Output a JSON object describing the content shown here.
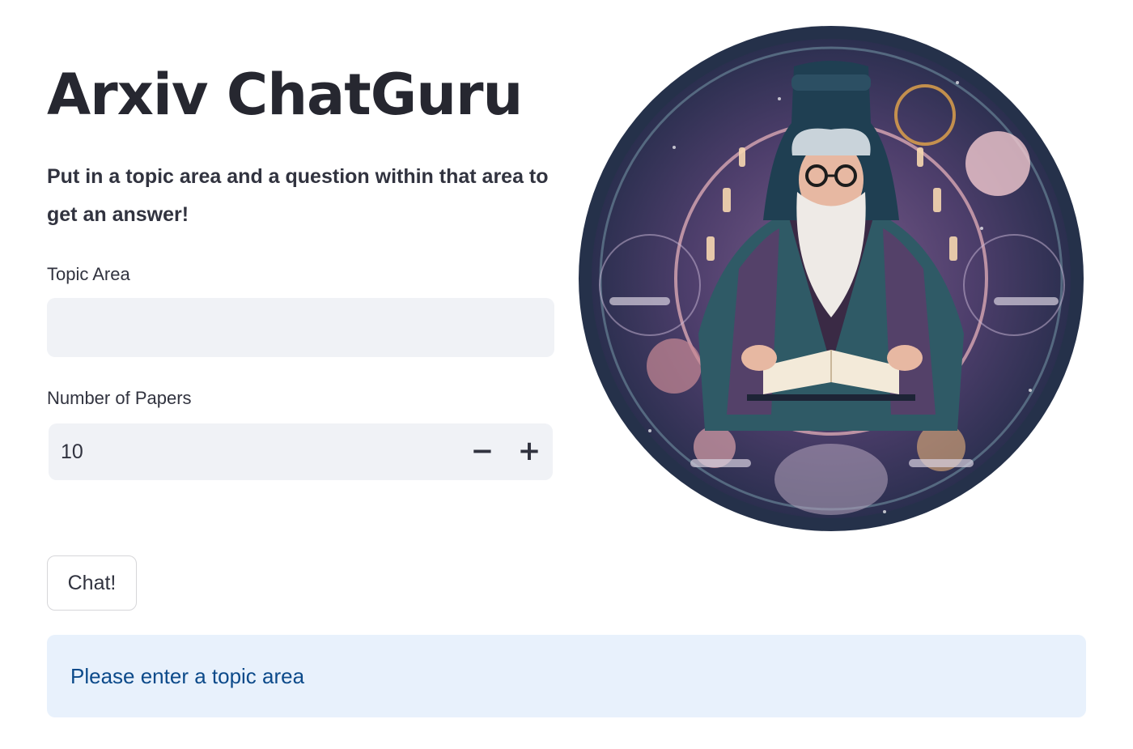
{
  "header": {
    "title": "Arxiv ChatGuru",
    "subtitle": "Put in a topic area and a question within that area to get an answer!"
  },
  "form": {
    "topic": {
      "label": "Topic Area",
      "value": "",
      "placeholder": ""
    },
    "papers": {
      "label": "Number of Papers",
      "value": "10",
      "minus_icon": "minus-icon",
      "plus_icon": "plus-icon"
    },
    "chat_label": "Chat!"
  },
  "info": {
    "message": "Please enter a topic area"
  },
  "image": {
    "icon": "wizard-illustration"
  },
  "colors": {
    "input_bg": "#f0f2f6",
    "info_bg": "#e8f1fc",
    "info_text": "#0c4a8a",
    "text": "#31333f"
  }
}
